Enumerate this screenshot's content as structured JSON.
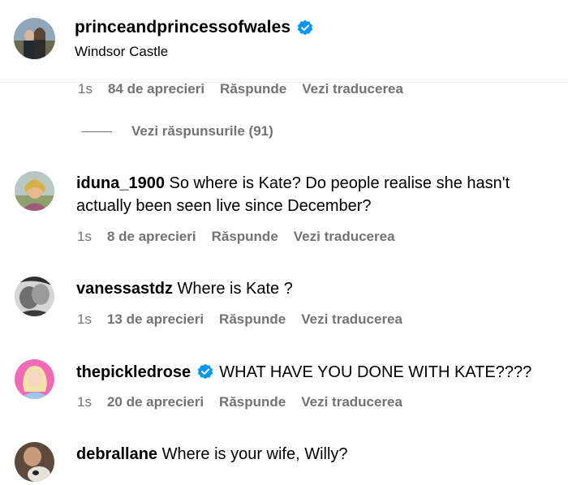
{
  "header": {
    "username": "princeandprincessofwales",
    "location": "Windsor Castle"
  },
  "top_meta": {
    "time": "1s",
    "likes": "84 de aprecieri",
    "reply": "Răspunde",
    "translate": "Vezi traducerea"
  },
  "view_replies": "Vezi răspunsurile (91)",
  "comments": [
    {
      "user": "iduna_1900",
      "text": "So where is Kate? Do people realise she hasn't actually been seen live since December?",
      "time": "1s",
      "likes": "8 de aprecieri",
      "reply": "Răspunde",
      "translate": "Vezi traducerea"
    },
    {
      "user": "vanessastdz",
      "text": "Where is Kate ?",
      "time": "1s",
      "likes": "13 de aprecieri",
      "reply": "Răspunde",
      "translate": "Vezi traducerea"
    },
    {
      "user": "thepickledrose",
      "text": "WHAT HAVE YOU DONE WITH KATE????",
      "time": "1s",
      "likes": "20 de aprecieri",
      "reply": "Răspunde",
      "translate": "Vezi traducerea"
    },
    {
      "user": "debrallane",
      "text": "Where is your wife, Willy?"
    }
  ],
  "colors": {
    "verified": "#0095f6",
    "meta_text": "#737373",
    "divider": "#efefef"
  },
  "icons": [
    "verified-badge-icon"
  ]
}
